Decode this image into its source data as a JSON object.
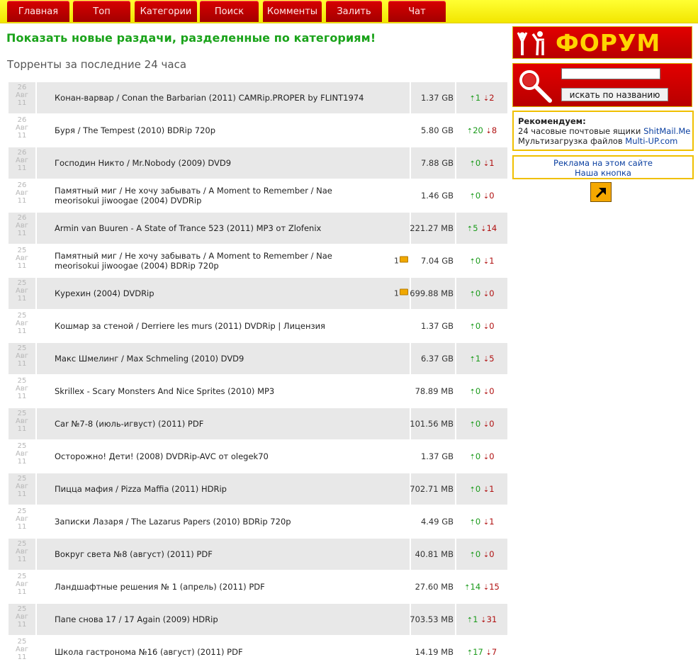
{
  "nav": {
    "tabs": [
      "Главная",
      "Топ",
      "Категории",
      "Поиск",
      "Комменты",
      "Залить",
      "Чат"
    ]
  },
  "main": {
    "headline": "Показать новые раздачи, разделенные по категориям!",
    "subheading": "Торренты за последние 24 часа",
    "torrents": [
      {
        "day": "26",
        "month": "Авг",
        "year": "11",
        "title": "Конан-варвар / Conan the Barbarian (2011) CAMRip.PROPER by FLINT1974",
        "comments": "",
        "size": "1.37 GB",
        "seeders": "1",
        "leechers": "2"
      },
      {
        "day": "26",
        "month": "Авг",
        "year": "11",
        "title": "Буря / The Tempest (2010) BDRip 720p",
        "comments": "",
        "size": "5.80 GB",
        "seeders": "20",
        "leechers": "8"
      },
      {
        "day": "26",
        "month": "Авг",
        "year": "11",
        "title": "Господин Никто / Mr.Nobody (2009) DVD9",
        "comments": "",
        "size": "7.88 GB",
        "seeders": "0",
        "leechers": "1"
      },
      {
        "day": "26",
        "month": "Авг",
        "year": "11",
        "title": "Памятный миг / Не хочу забывать / A Moment to Remember / Nae meorisokui jiwoogae (2004) DVDRip",
        "comments": "",
        "size": "1.46 GB",
        "seeders": "0",
        "leechers": "0"
      },
      {
        "day": "26",
        "month": "Авг",
        "year": "11",
        "title": "Armin van Buuren - A State of Trance 523 (2011) MP3 от Zlofenix",
        "comments": "",
        "size": "221.27 MB",
        "seeders": "5",
        "leechers": "14"
      },
      {
        "day": "25",
        "month": "Авг",
        "year": "11",
        "title": "Памятный миг / Не хочу забывать / A Moment to Remember / Nae meorisokui jiwoogae (2004) BDRip 720p",
        "comments": "1",
        "size": "7.04 GB",
        "seeders": "0",
        "leechers": "1"
      },
      {
        "day": "25",
        "month": "Авг",
        "year": "11",
        "title": "Курехин (2004) DVDRip",
        "comments": "1",
        "size": "699.88 MB",
        "seeders": "0",
        "leechers": "0"
      },
      {
        "day": "25",
        "month": "Авг",
        "year": "11",
        "title": "Кошмар за стеной / Derriere les murs (2011) DVDRip | Лицензия",
        "comments": "",
        "size": "1.37 GB",
        "seeders": "0",
        "leechers": "0"
      },
      {
        "day": "25",
        "month": "Авг",
        "year": "11",
        "title": "Макс Шмелинг / Max Schmeling (2010) DVD9",
        "comments": "",
        "size": "6.37 GB",
        "seeders": "1",
        "leechers": "5"
      },
      {
        "day": "25",
        "month": "Авг",
        "year": "11",
        "title": "Skrillex - Scary Monsters And Nice Sprites (2010) MP3",
        "comments": "",
        "size": "78.89 MB",
        "seeders": "0",
        "leechers": "0"
      },
      {
        "day": "25",
        "month": "Авг",
        "year": "11",
        "title": "Car №7-8 (июль-игвуст) (2011) PDF",
        "comments": "",
        "size": "101.56 MB",
        "seeders": "0",
        "leechers": "0"
      },
      {
        "day": "25",
        "month": "Авг",
        "year": "11",
        "title": "Осторожно! Дети! (2008) DVDRip-AVC от olegek70",
        "comments": "",
        "size": "1.37 GB",
        "seeders": "0",
        "leechers": "0"
      },
      {
        "day": "25",
        "month": "Авг",
        "year": "11",
        "title": "Пицца мафия / Pizza Maffia (2011) HDRip",
        "comments": "",
        "size": "702.71 MB",
        "seeders": "0",
        "leechers": "1"
      },
      {
        "day": "25",
        "month": "Авг",
        "year": "11",
        "title": "Записки Лазаря / The Lazarus Papers (2010) BDRip 720p",
        "comments": "",
        "size": "4.49 GB",
        "seeders": "0",
        "leechers": "1"
      },
      {
        "day": "25",
        "month": "Авг",
        "year": "11",
        "title": "Вокруг света №8 (август) (2011) PDF",
        "comments": "",
        "size": "40.81 MB",
        "seeders": "0",
        "leechers": "0"
      },
      {
        "day": "25",
        "month": "Авг",
        "year": "11",
        "title": "Ландшафтные решения № 1 (апрель) (2011) PDF",
        "comments": "",
        "size": "27.60 MB",
        "seeders": "14",
        "leechers": "15"
      },
      {
        "day": "25",
        "month": "Авг",
        "year": "11",
        "title": "Папе снова 17 / 17 Again (2009) HDRip",
        "comments": "",
        "size": "703.53 MB",
        "seeders": "1",
        "leechers": "31"
      },
      {
        "day": "25",
        "month": "Авг",
        "year": "11",
        "title": "Школа гастронома №16 (август) (2011) PDF",
        "comments": "",
        "size": "14.19 MB",
        "seeders": "17",
        "leechers": "7"
      }
    ]
  },
  "sidebar": {
    "forum_label": "ФОРУМ",
    "search": {
      "placeholder": "",
      "button_label": "искать по названию"
    },
    "recommend": {
      "title": "Рекомендуем",
      "line1_prefix": "24 часовые почтовые ящики",
      "line1_link": "ShitMail.Me",
      "line2_prefix": "Мультизагрузка файлов",
      "line2_link": "Multi-UP.com"
    },
    "ads": {
      "link1": "Реклама на этом сайте",
      "link2": "Наша кнопка"
    }
  },
  "icons": {
    "forum": "forum-people-icon",
    "search": "magnifier-icon",
    "comment": "comment-bubble-icon",
    "seed": "arrow-up-icon",
    "leech": "arrow-down-icon",
    "button": "diagonal-arrow-icon"
  },
  "colors": {
    "topbar": "#ffff00",
    "tab": "#c00000",
    "headline": "#1aa31a",
    "seed": "#1a9a1a",
    "leech": "#b01010",
    "border": "#f0c000"
  }
}
